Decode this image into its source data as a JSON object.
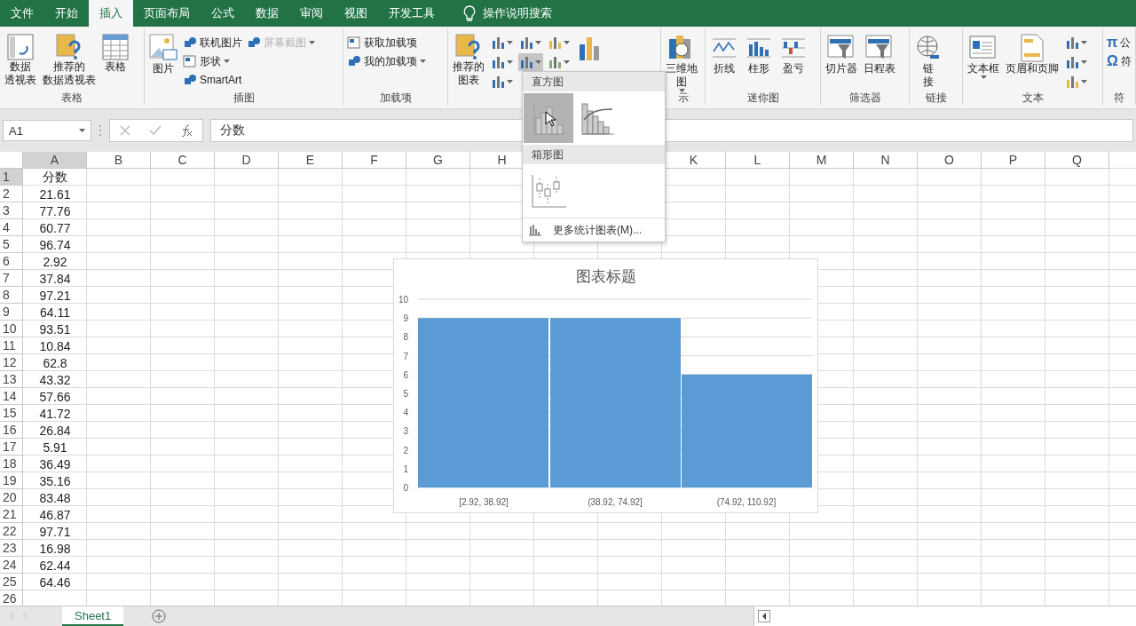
{
  "ribbon_tabs": [
    {
      "label": "文件",
      "selected": false
    },
    {
      "label": "开始",
      "selected": false
    },
    {
      "label": "插入",
      "selected": true
    },
    {
      "label": "页面布局",
      "selected": false
    },
    {
      "label": "公式",
      "selected": false
    },
    {
      "label": "数据",
      "selected": false
    },
    {
      "label": "审阅",
      "selected": false
    },
    {
      "label": "视图",
      "selected": false
    },
    {
      "label": "开发工具",
      "selected": false
    }
  ],
  "tell_me": "操作说明搜索",
  "ribbon_groups": [
    {
      "label": "表格",
      "items": [
        {
          "kind": "large",
          "lines": [
            "数据",
            "透视表"
          ],
          "dropdown": false
        },
        {
          "kind": "large",
          "lines": [
            "推荐的",
            "数据透视表"
          ],
          "dropdown": false
        },
        {
          "kind": "large",
          "lines": [
            "表格"
          ],
          "dropdown": false
        }
      ]
    },
    {
      "label": "插图",
      "items": [
        {
          "kind": "large",
          "lines": [
            "图片"
          ],
          "dropdown": false
        },
        {
          "kind": "stack",
          "buttons": [
            {
              "label": "联机图片",
              "dropdown": false,
              "disabled": false
            },
            {
              "label": "形状",
              "dropdown": true,
              "disabled": false
            },
            {
              "label": "SmartArt",
              "dropdown": false,
              "disabled": false
            }
          ]
        },
        {
          "kind": "stack",
          "buttons": [
            {
              "label": "屏幕截图",
              "dropdown": true,
              "disabled": true
            }
          ]
        }
      ]
    },
    {
      "label": "加载项",
      "items": [
        {
          "kind": "stack",
          "buttons": [
            {
              "label": "获取加载项",
              "dropdown": false,
              "disabled": false
            },
            {
              "label": "我的加载项",
              "dropdown": true,
              "disabled": false
            }
          ]
        }
      ]
    },
    {
      "items": [
        {
          "kind": "large",
          "lines": [
            "推荐的",
            "图表"
          ],
          "dropdown": false
        },
        {
          "kind": "iconbar",
          "buttons": [
            {
              "selected": false
            },
            {
              "selected": false
            },
            {
              "selected": false
            },
            {
              "selected": false
            },
            {
              "selected": true
            },
            {
              "selected": false
            },
            {
              "selected": false
            }
          ]
        },
        {
          "kind": "large",
          "dropdown": false
        }
      ]
    },
    {
      "label": "示",
      "items": [
        {
          "kind": "large",
          "lines": [
            "三维地",
            "图"
          ],
          "dropdown": true
        }
      ]
    },
    {
      "label": "迷你图",
      "items": [
        {
          "kind": "large",
          "lines": [
            "折线"
          ],
          "dropdown": false
        },
        {
          "kind": "large",
          "lines": [
            "柱形"
          ],
          "dropdown": false
        },
        {
          "kind": "large",
          "lines": [
            "盈亏"
          ],
          "dropdown": false
        }
      ]
    },
    {
      "label": "筛选器",
      "items": [
        {
          "kind": "large",
          "lines": [
            "切片器"
          ],
          "dropdown": false
        },
        {
          "kind": "large",
          "lines": [
            "日程表"
          ],
          "dropdown": false
        }
      ]
    },
    {
      "label": "链接",
      "items": [
        {
          "kind": "large",
          "lines": [
            "链",
            "接"
          ],
          "dropdown": false
        }
      ]
    },
    {
      "label": "文本",
      "items": [
        {
          "kind": "large",
          "lines": [
            "文本框"
          ],
          "dropdown": true
        },
        {
          "kind": "large",
          "lines": [
            "页眉和页脚"
          ],
          "dropdown": false
        },
        {
          "kind": "iconbar",
          "buttons": [
            {
              "selected": false
            },
            {
              "selected": false
            },
            {
              "selected": false
            }
          ]
        }
      ]
    },
    {
      "label": "符",
      "items": [
        {
          "kind": "symbols",
          "buttons": [
            {
              "glyph": "π",
              "label": "公"
            },
            {
              "glyph": "Ω",
              "label": "符"
            }
          ]
        }
      ]
    }
  ],
  "chart_menu": {
    "sections": [
      {
        "title": "直方图",
        "items": [
          {
            "kind": "histogram",
            "selected": true
          },
          {
            "kind": "pareto",
            "selected": false
          }
        ]
      },
      {
        "title": "箱形图",
        "items": [
          {
            "kind": "box-whisker",
            "selected": false
          }
        ]
      }
    ],
    "more": "更多统计图表(M)..."
  },
  "formula_bar": {
    "name_box": "A1",
    "value": "分数"
  },
  "sheet": {
    "columns": [
      {
        "label": "A"
      },
      {
        "label": "B"
      },
      {
        "label": "C"
      },
      {
        "label": "D"
      },
      {
        "label": "E"
      },
      {
        "label": "F"
      },
      {
        "label": "G"
      },
      {
        "label": "H"
      },
      {},
      {},
      {
        "label": "K"
      },
      {
        "label": "L"
      },
      {
        "label": "M"
      },
      {
        "label": "N"
      },
      {
        "label": "O"
      },
      {
        "label": "P"
      },
      {
        "label": "Q"
      }
    ],
    "rows": [
      {
        "number": "1",
        "a": "分数"
      },
      {
        "number": "2",
        "a": "21.61"
      },
      {
        "number": "3",
        "a": "77.76"
      },
      {
        "number": "4",
        "a": "60.77"
      },
      {
        "number": "5",
        "a": "96.74"
      },
      {
        "number": "6",
        "a": "2.92"
      },
      {
        "number": "7",
        "a": "37.84"
      },
      {
        "number": "8",
        "a": "97.21"
      },
      {
        "number": "9",
        "a": "64.11"
      },
      {
        "number": "10",
        "a": "93.51"
      },
      {
        "number": "11",
        "a": "10.84"
      },
      {
        "number": "12",
        "a": "62.8"
      },
      {
        "number": "13",
        "a": "43.32"
      },
      {
        "number": "14",
        "a": "57.66"
      },
      {
        "number": "15",
        "a": "41.72"
      },
      {
        "number": "16",
        "a": "26.84"
      },
      {
        "number": "17",
        "a": "5.91"
      },
      {
        "number": "18",
        "a": "36.49"
      },
      {
        "number": "19",
        "a": "35.16"
      },
      {
        "number": "20",
        "a": "83.48"
      },
      {
        "number": "21",
        "a": "46.87"
      },
      {
        "number": "22",
        "a": "97.71"
      },
      {
        "number": "23",
        "a": "16.98"
      },
      {
        "number": "24",
        "a": "62.44"
      },
      {
        "number": "25",
        "a": "64.46"
      },
      {
        "number": "26"
      }
    ]
  },
  "chart": {
    "chart_data": {
      "type": "bar",
      "title": "图表标题",
      "categories": [
        "[2.92, 38.92]",
        "(38.92, 74.92]",
        "(74.92, 110.92]"
      ],
      "values": [
        9,
        9,
        6
      ],
      "ylim": [
        0,
        10
      ],
      "yticks": [
        0,
        1,
        2,
        3,
        4,
        5,
        6,
        7,
        8,
        9,
        10
      ],
      "grid": true
    }
  },
  "sheet_tabs": [
    {
      "label": "Sheet1",
      "selected": true
    }
  ]
}
